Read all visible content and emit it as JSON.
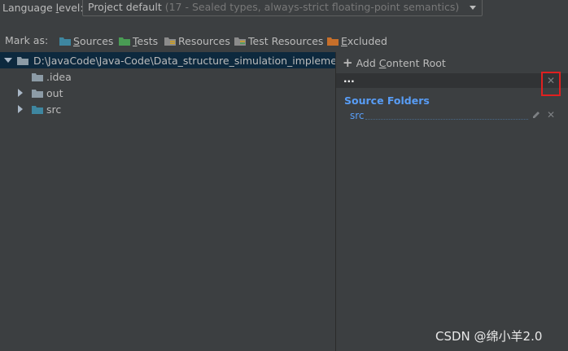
{
  "language": {
    "label_prefix": "Language ",
    "label_underlined": "l",
    "label_suffix": "evel:",
    "selected_value": "Project default",
    "selected_hint": " (17 - Sealed types, always-strict floating-point semantics)"
  },
  "mark_as": {
    "label": "Mark as:",
    "buttons": [
      {
        "u": "S",
        "rest": "ources",
        "icon": "sources-folder-icon",
        "color": "#3e86a0"
      },
      {
        "u": "T",
        "rest": "ests",
        "icon": "tests-folder-icon",
        "color": "#499c54"
      },
      {
        "u": "",
        "rest": "Resources",
        "icon": "resources-folder-icon",
        "color": "#8b8b8b"
      },
      {
        "u": "",
        "rest": "Test Resources",
        "icon": "test-resources-folder-icon",
        "color": "#8b8b8b"
      },
      {
        "u": "E",
        "rest": "xcluded",
        "icon": "excluded-folder-icon",
        "color": "#c76f2a"
      }
    ]
  },
  "tree": {
    "root": "D:\\JavaCode\\Java-Code\\Data_structure_simulation_implementation",
    "children": [
      {
        "label": ".idea",
        "expandable": false,
        "color": "#8c9ba6"
      },
      {
        "label": "out",
        "expandable": true,
        "color": "#8c9ba6"
      },
      {
        "label": "src",
        "expandable": true,
        "color": "#3e86a0"
      }
    ]
  },
  "right_panel": {
    "add_content_root_prefix": "Add ",
    "add_content_root_underlined": "C",
    "add_content_root_suffix": "ontent Root",
    "content_root_label": "...",
    "source_folders_title": "Source Folders",
    "source_folders": [
      "src"
    ]
  },
  "watermark": "CSDN @绵小羊2.0",
  "colors": {
    "background": "#3c3f41",
    "selection": "#0d293e",
    "source_blue": "#589df6",
    "highlight": "#e02020"
  }
}
